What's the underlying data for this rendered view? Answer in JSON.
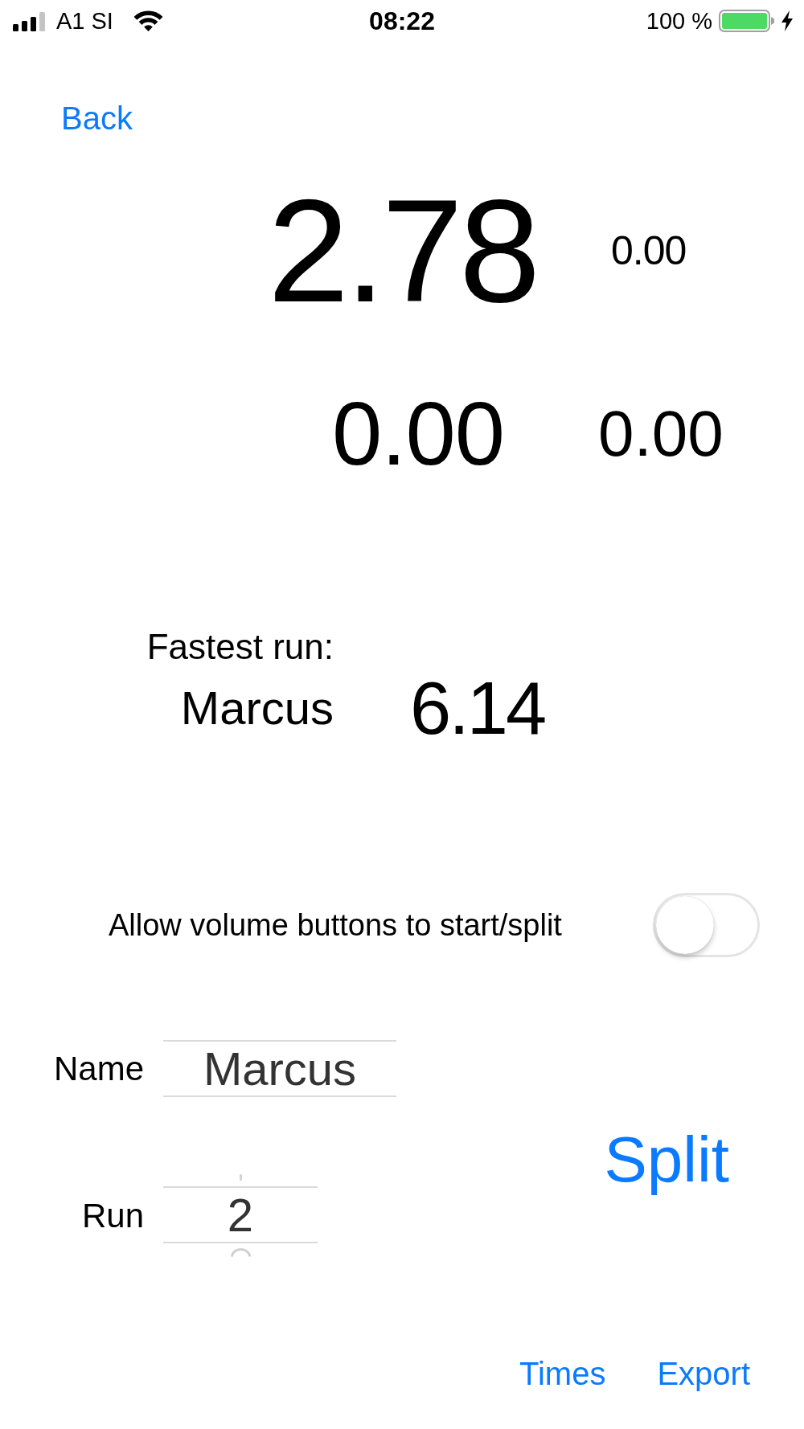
{
  "status_bar": {
    "carrier": "A1 SI",
    "time": "08:22",
    "battery": "100 %",
    "charging": true
  },
  "nav": {
    "back": "Back"
  },
  "timer": {
    "primary_time": "2.78",
    "primary_side": "0.00",
    "secondary_time": "0.00",
    "secondary_side": "0.00"
  },
  "fastest_run": {
    "label": "Fastest run:",
    "name": "Marcus",
    "time": "6.14"
  },
  "volume_toggle": {
    "label": "Allow volume buttons to start/split",
    "on": false
  },
  "name_field": {
    "label": "Name",
    "value": "Marcus"
  },
  "run_picker": {
    "label": "Run",
    "value": "2"
  },
  "split_button": "Split",
  "toolbar": [
    "Times",
    "Export"
  ]
}
